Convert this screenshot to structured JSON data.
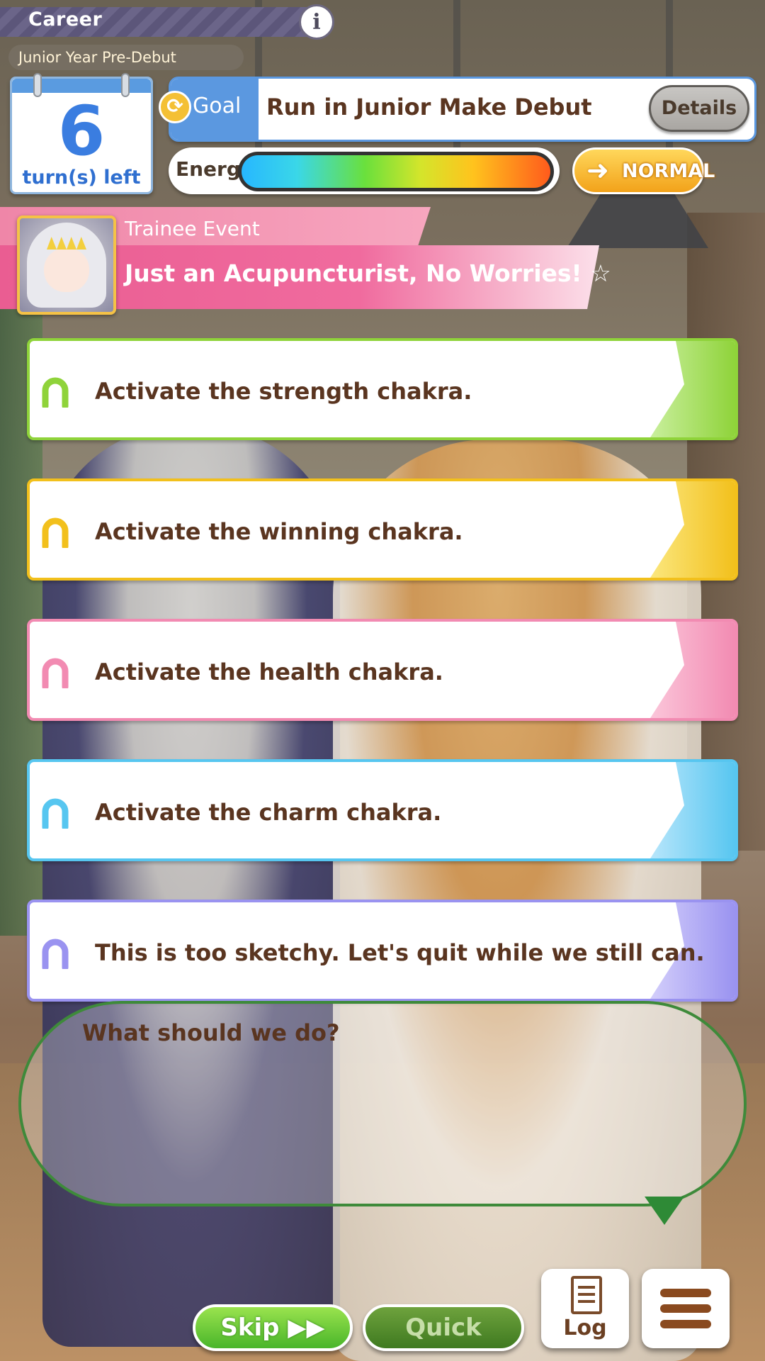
{
  "header": {
    "title": "Career",
    "info_glyph": "i",
    "period": "Junior Year Pre-Debut"
  },
  "calendar": {
    "turns": "6",
    "label": "turn(s) left"
  },
  "goal": {
    "tag": "Goal",
    "text": "Run in Junior Make Debut",
    "details_label": "Details"
  },
  "energy": {
    "label": "Energy",
    "level": 1.0
  },
  "mood": {
    "label": "NORMAL",
    "arrow": "➜"
  },
  "event": {
    "type": "Trainee Event",
    "title": "Just an Acupuncturist, No Worries! ☆"
  },
  "choices": [
    {
      "text": "Activate the strength chakra.",
      "color": "#8fd33a",
      "edge": "#c9ef9d"
    },
    {
      "text": "Activate the winning chakra.",
      "color": "#f2c01c",
      "edge": "#fbe77e"
    },
    {
      "text": "Activate the health chakra.",
      "color": "#f28bb2",
      "edge": "#fbc6da"
    },
    {
      "text": "Activate the charm chakra.",
      "color": "#57c6f0",
      "edge": "#b8e6fb"
    },
    {
      "text": "This is too sketchy. Let's quit while we still can.",
      "color": "#9a93f0",
      "edge": "#d3cefb"
    }
  ],
  "dialog": {
    "text": "What should we do?"
  },
  "controls": {
    "skip_label": "Skip ▶▶",
    "quick_label": "Quick",
    "log_label": "Log"
  },
  "colors": {
    "accent_blue": "#5b98e0",
    "event_pink": "#ea5d92",
    "dialog_border": "#3e8a3a",
    "text_brown": "#5a3520"
  }
}
